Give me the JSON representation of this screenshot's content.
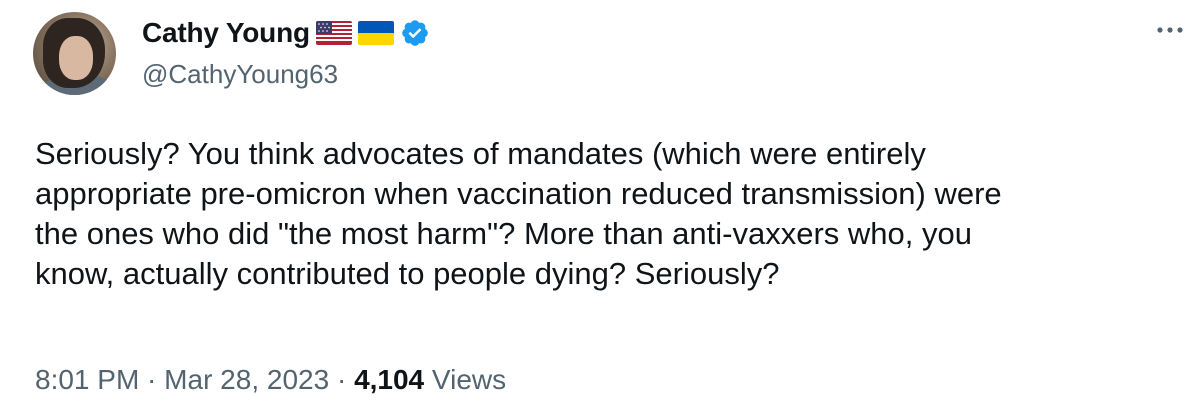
{
  "author": {
    "display_name": "Cathy Young",
    "handle": "@CathyYoung63",
    "flags": [
      "us-flag-icon",
      "ukraine-flag-icon"
    ],
    "verified": true,
    "verified_color": "#1d9bf0"
  },
  "tweet": {
    "text": "Seriously? You think advocates of mandates (which were entirely\nappropriate pre-omicron when vaccination reduced transmission) were\nthe ones who did \"the most harm\"? More than anti-vaxxers who, you\nknow, actually contributed to people dying? Seriously?",
    "time": "8:01 PM",
    "separator": " · ",
    "date": "Mar 28, 2023",
    "views_count": "4,104",
    "views_label": "Views"
  },
  "colors": {
    "text_primary": "#0f1419",
    "text_secondary": "#536471",
    "accent": "#1d9bf0"
  },
  "icons": {
    "more": "more-horizontal-icon"
  }
}
